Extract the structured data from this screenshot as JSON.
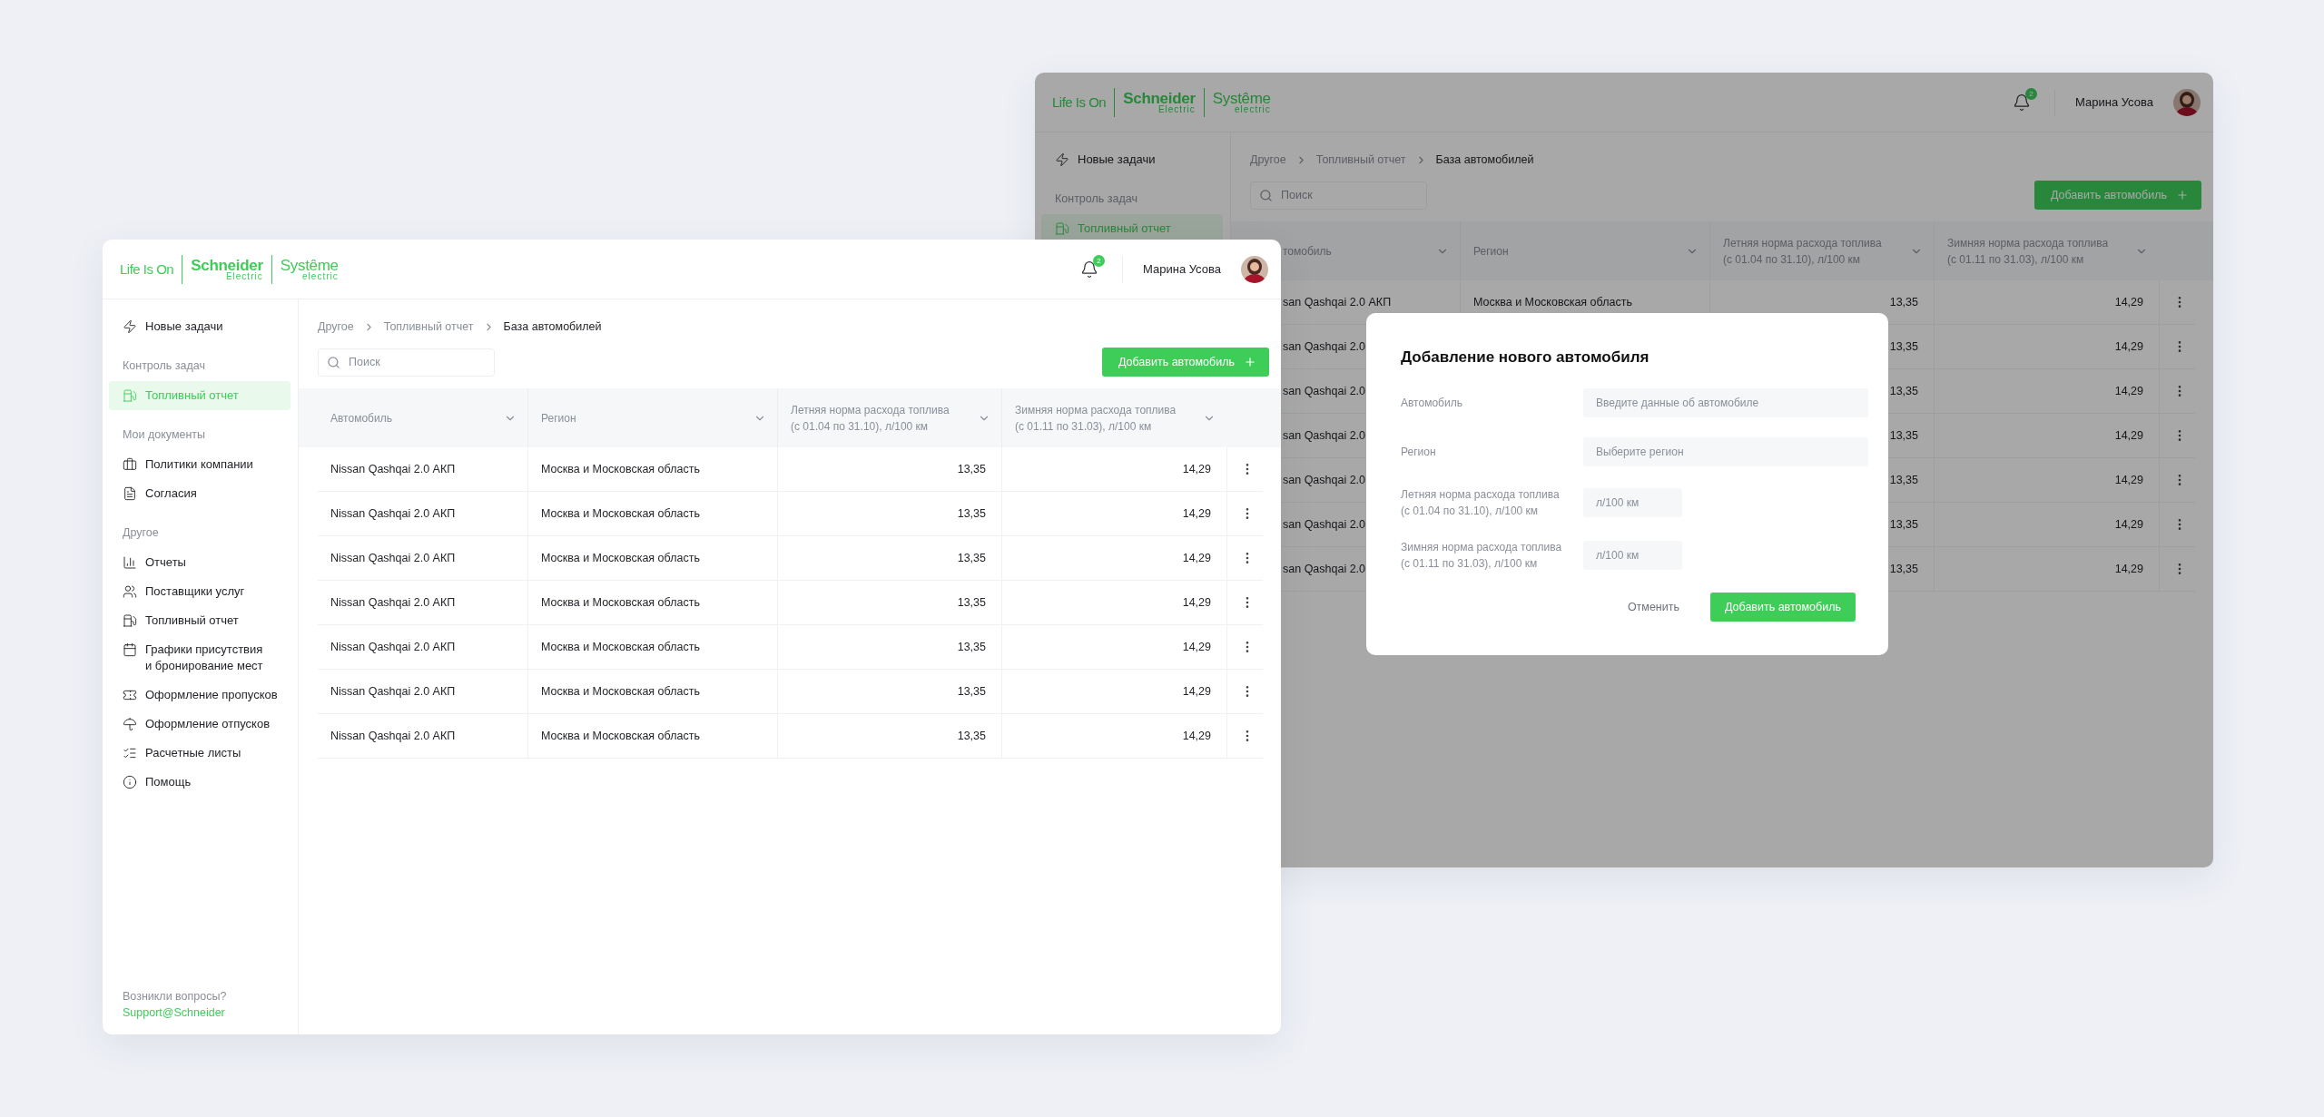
{
  "back_window": {
    "header": {
      "logo": {
        "tagline": "Life Is On",
        "brand": "Schneider",
        "brand_sub": "Electric",
        "partner": "Systême",
        "partner_sub": "electric"
      },
      "notifications": "2",
      "user_name": "Марина Усова"
    },
    "sidebar": {
      "sections": [
        {
          "items": [
            {
              "label": "Новые задачи",
              "selected": false
            }
          ]
        },
        {
          "title": "Контроль задач",
          "items": [
            {
              "label": "Топливный отчет",
              "selected": true
            }
          ]
        }
      ]
    },
    "breadcrumbs": [
      "Другое",
      "Топливный отчет",
      "База автомобилей"
    ],
    "search": {
      "placeholder": "Поиск"
    },
    "add_button": "Добавить автомобиль",
    "table": {
      "columns": [
        "томобиль",
        "Регион",
        "Летняя норма расхода топлива\n (с 01.04 по 31.10), л/100 км",
        "Зимняя норма расхода топлива\n(с 01.11 по 31.03), л/100 км"
      ],
      "rows": [
        {
          "car": "san Qashqai 2.0 АКП",
          "region": "Москва и Московская область",
          "summer": "13,35",
          "winter": "14,29"
        },
        {
          "car": "san Qashqai 2.0",
          "summer": "13,35",
          "winter": "14,29"
        },
        {
          "car": "san Qashqai 2.0",
          "summer": "13,35",
          "winter": "14,29"
        },
        {
          "car": "san Qashqai 2.0",
          "summer": "13,35",
          "winter": "14,29"
        },
        {
          "car": "san Qashqai 2.0",
          "summer": "13,35",
          "winter": "14,29"
        },
        {
          "car": "san Qashqai 2.0",
          "summer": "13,35",
          "winter": "14,29"
        },
        {
          "car": "san Qashqai 2.0",
          "summer": "13,35",
          "winter": "14,29"
        }
      ]
    },
    "modal": {
      "title": "Добавление нового автомобиля",
      "fields": [
        {
          "label": "Автомобиль",
          "placeholder": "Введите данные об автомобиле",
          "kind": "wide"
        },
        {
          "label": "Регион",
          "placeholder": "Выберите регион",
          "kind": "wide"
        },
        {
          "label": "Летняя норма расхода топлива\n(с 01.04 по 31.10), л/100 км",
          "placeholder": "л/100 км",
          "kind": "short"
        },
        {
          "label": "Зимняя норма расхода топлива\n(с 01.11 по 31.03), л/100 км",
          "placeholder": "л/100 км",
          "kind": "short"
        }
      ],
      "cancel": "Отменить",
      "submit": "Добавить автомобиль"
    }
  },
  "front_window": {
    "header": {
      "logo": {
        "tagline": "Life Is On",
        "brand": "Schneider",
        "brand_sub": "Electric",
        "partner": "Systême",
        "partner_sub": "electric"
      },
      "notifications": "2",
      "user_name": "Марина Усова"
    },
    "sidebar": {
      "sections": [
        {
          "items": [
            {
              "label": "Новые задачи",
              "selected": false
            }
          ]
        },
        {
          "title": "Контроль задач",
          "items": [
            {
              "label": "Топливный отчет",
              "selected": true
            }
          ]
        },
        {
          "title": "Мои документы",
          "items": [
            {
              "label": "Политики компании",
              "selected": false
            },
            {
              "label": "Согласия",
              "selected": false
            }
          ]
        },
        {
          "title": "Другое",
          "items": [
            {
              "label": "Отчеты",
              "selected": false
            },
            {
              "label": "Поставщики услуг",
              "selected": false
            },
            {
              "label": "Топливный отчет",
              "selected": false
            },
            {
              "label": "Графики присутствия\n и бронирование мест",
              "selected": false
            },
            {
              "label": "Оформление пропусков",
              "selected": false
            },
            {
              "label": "Оформление отпусков",
              "selected": false
            },
            {
              "label": "Расчетные листы",
              "selected": false
            },
            {
              "label": "Помощь",
              "selected": false
            }
          ]
        }
      ],
      "footer": {
        "question": "Возникли вопросы?",
        "link": "Support@Schneider"
      }
    },
    "breadcrumbs": [
      "Другое",
      "Топливный отчет",
      "База автомобилей"
    ],
    "search": {
      "placeholder": "Поиск"
    },
    "add_button": "Добавить автомобиль",
    "table": {
      "columns": [
        "Автомобиль",
        "Регион",
        "Летняя норма расхода топлива\n (с 01.04 по 31.10), л/100 км",
        "Зимняя норма расхода топлива\n(с 01.11 по 31.03), л/100 км"
      ],
      "rows": [
        {
          "car": "Nissan Qashqai 2.0 АКП",
          "region": "Москва и Московская область",
          "summer": "13,35",
          "winter": "14,29"
        },
        {
          "car": "Nissan Qashqai 2.0 АКП",
          "region": "Москва и Московская область",
          "summer": "13,35",
          "winter": "14,29"
        },
        {
          "car": "Nissan Qashqai 2.0 АКП",
          "region": "Москва и Московская область",
          "summer": "13,35",
          "winter": "14,29"
        },
        {
          "car": "Nissan Qashqai 2.0 АКП",
          "region": "Москва и Московская область",
          "summer": "13,35",
          "winter": "14,29"
        },
        {
          "car": "Nissan Qashqai 2.0 АКП",
          "region": "Москва и Московская область",
          "summer": "13,35",
          "winter": "14,29"
        },
        {
          "car": "Nissan Qashqai 2.0 АКП",
          "region": "Москва и Московская область",
          "summer": "13,35",
          "winter": "14,29"
        },
        {
          "car": "Nissan Qashqai 2.0 АКП",
          "region": "Москва и Московская область",
          "summer": "13,35",
          "winter": "14,29"
        }
      ]
    }
  }
}
